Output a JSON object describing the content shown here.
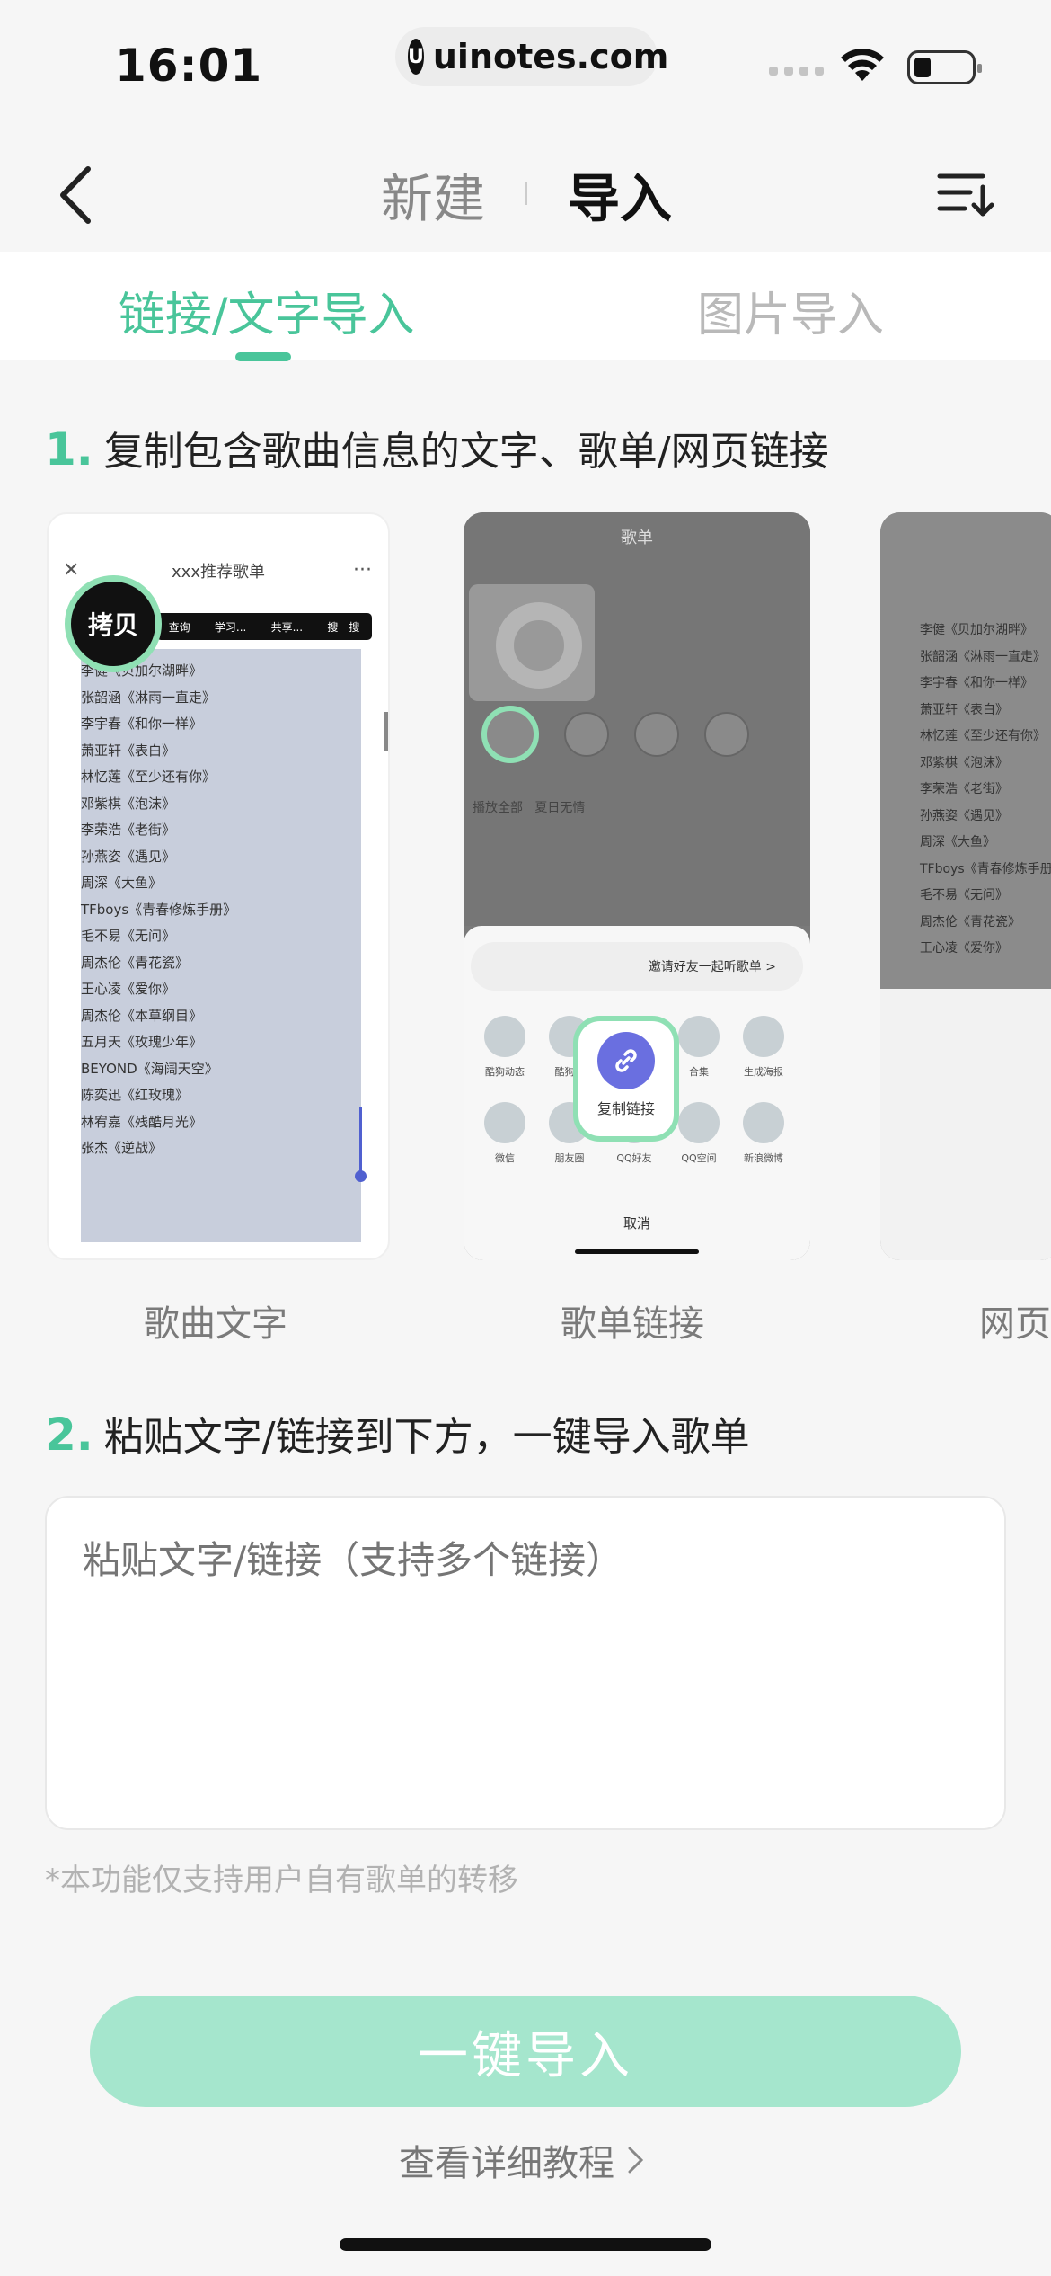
{
  "status_bar": {
    "time": "16:01",
    "url": "uinotes.com"
  },
  "nav": {
    "segment_new": "新建",
    "segment_import": "导入"
  },
  "tabs": [
    {
      "label": "链接/文字导入",
      "active": true
    },
    {
      "label": "图片导入",
      "active": false
    }
  ],
  "step1": {
    "num": "1.",
    "text": "复制包含歌曲信息的文字、歌单/网页链接"
  },
  "examples": [
    {
      "caption": "歌曲文字"
    },
    {
      "caption": "歌单链接"
    },
    {
      "caption": "网页"
    }
  ],
  "example_a": {
    "header": "xxx推荐歌单",
    "copy_label": "拷贝",
    "menu": [
      "查询",
      "学习...",
      "共享...",
      "搜一搜"
    ],
    "songs": [
      "李健《贝加尔湖畔》",
      "张韶涵《淋雨一直走》",
      "李宇春《和你一样》",
      "萧亚轩《表白》",
      "林忆莲《至少还有你》",
      "邓紫棋《泡沫》",
      "李荣浩《老街》",
      "孙燕姿《遇见》",
      "周深《大鱼》",
      "TFboys《青春修炼手册》",
      "毛不易《无问》",
      "周杰伦《青花瓷》",
      "王心凌《爱你》",
      "周杰伦《本草纲目》",
      "五月天《玫瑰少年》",
      "BEYOND《海阔天空》",
      "陈奕迅《红玫瑰》",
      "林宥嘉《残酷月光》",
      "张杰《逆战》"
    ]
  },
  "example_b": {
    "title": "歌单",
    "play_all": "播放全部",
    "song_title": "夏日无情",
    "invite": "邀请好友一起听歌单 >",
    "copy_link": "复制链接",
    "share_items": [
      "酷狗动态",
      "酷狗码",
      "",
      "合集",
      "生成海报",
      "微信",
      "朋友圈",
      "QQ好友",
      "QQ空间",
      "新浪微博"
    ],
    "cancel": "取消"
  },
  "example_c": {
    "songs": [
      "李健《贝加尔湖畔》",
      "张韶涵《淋雨一直走》",
      "李宇春《和你一样》",
      "萧亚轩《表白》",
      "林忆莲《至少还有你》",
      "邓紫棋《泡沫》",
      "李荣浩《老街》",
      "孙燕姿《遇见》",
      "周深《大鱼》",
      "TFboys《青春修炼手册》",
      "毛不易《无问》",
      "周杰伦《青花瓷》",
      "王心凌《爱你》"
    ]
  },
  "step2": {
    "num": "2.",
    "text": "粘贴文字/链接到下方，一键导入歌单"
  },
  "paste_input": {
    "value": "",
    "placeholder": "粘贴文字/链接（支持多个链接）"
  },
  "note": "*本功能仅支持用户自有歌单的转移",
  "import_button": "一键导入",
  "tutorial_link": "查看详细教程",
  "colors": {
    "accent": "#49c59a",
    "button_disabled": "#a5e6cd",
    "highlight_ring": "#8fe0b4"
  }
}
